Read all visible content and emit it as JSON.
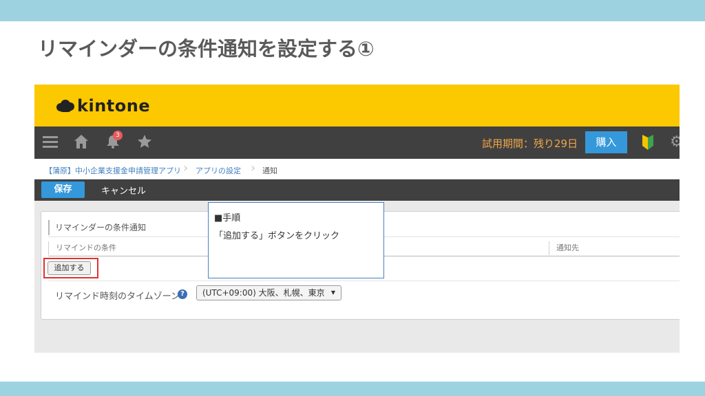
{
  "slide": {
    "title": "リマインダーの条件通知を設定する①"
  },
  "app": {
    "logo_text": "kintone",
    "notification_count": "3",
    "trial_text": "試用期間：残り29日",
    "buy_label": "購入"
  },
  "breadcrumb": {
    "items": [
      "【蒲原】中小企業支援金申請管理アプリ",
      "アプリの設定",
      "通知"
    ]
  },
  "actionbar": {
    "save_label": "保存",
    "cancel_label": "キャンセル"
  },
  "panel": {
    "section_title": "リマインダーの条件通知",
    "col_condition": "リマインドの条件",
    "col_recipient": "通知先",
    "add_button": "追加する",
    "timezone_label": "リマインド時刻のタイムゾーン",
    "timezone_value": "(UTC+09:00) 大阪、札幌、東京"
  },
  "callout": {
    "title": "■手順",
    "body": "「追加する」ボタンをクリック"
  },
  "colors": {
    "brand": "#fcc800",
    "toolbar": "#404040",
    "accent": "#3498db",
    "highlight": "#e03030",
    "band": "#9dd3e1"
  }
}
